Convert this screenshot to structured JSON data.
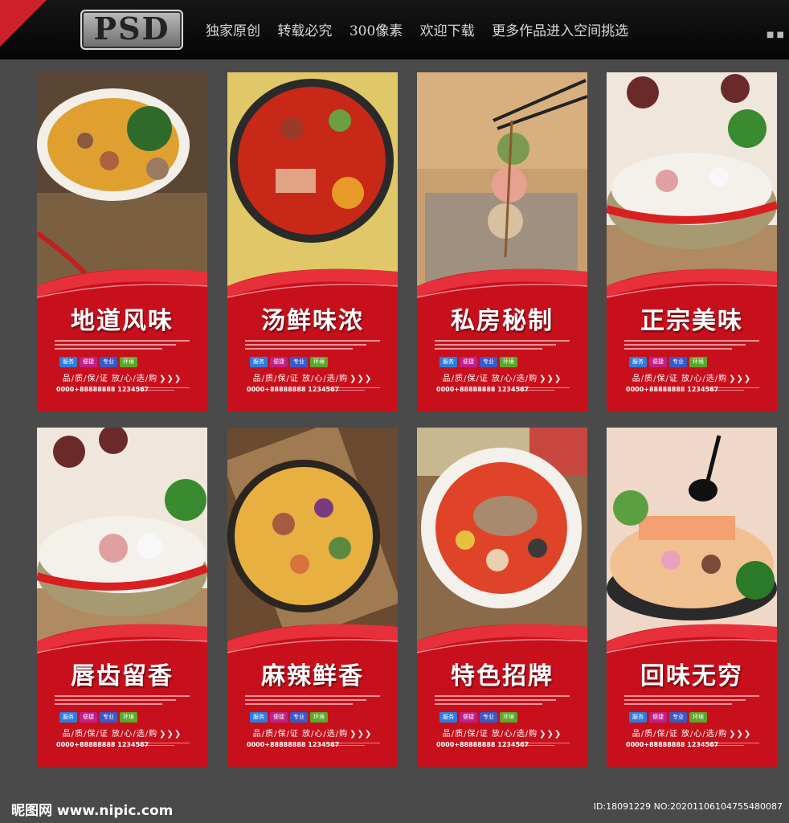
{
  "header": {
    "badge": "PSD",
    "tagline": [
      "独家原创",
      "转载必究",
      "300像素",
      "欢迎下载",
      "更多作品进入空间挑选"
    ],
    "mark": "■ ■"
  },
  "posters": [
    {
      "title": "地道风味",
      "phone": "0000+88888888 1234567"
    },
    {
      "title": "汤鲜味浓",
      "phone": "0000+88888888 1234567"
    },
    {
      "title": "私房秘制",
      "phone": "0000+88888888 1234567"
    },
    {
      "title": "正宗美味",
      "phone": "0000+88888888 1234567"
    },
    {
      "title": "唇齿留香",
      "phone": "0000+88888888 1234567"
    },
    {
      "title": "麻辣鲜香",
      "phone": "0000+88888888 1234567"
    },
    {
      "title": "特色招牌",
      "phone": "0000+88888888 1234567"
    },
    {
      "title": "回味无穷",
      "phone": "0000+88888888 1234567"
    }
  ],
  "badges": [
    "服务",
    "便捷",
    "专业",
    "环境"
  ],
  "tagline": "品/质/保/证 放/心/选/购",
  "footer": {
    "logo": "昵图网 www.nipic.com",
    "id": "ID:18091229 NO:20201106104755480087"
  },
  "colors": {
    "poster_red": "#c8101c",
    "accent_red": "#e8202a",
    "background": "#4a4a4a"
  }
}
